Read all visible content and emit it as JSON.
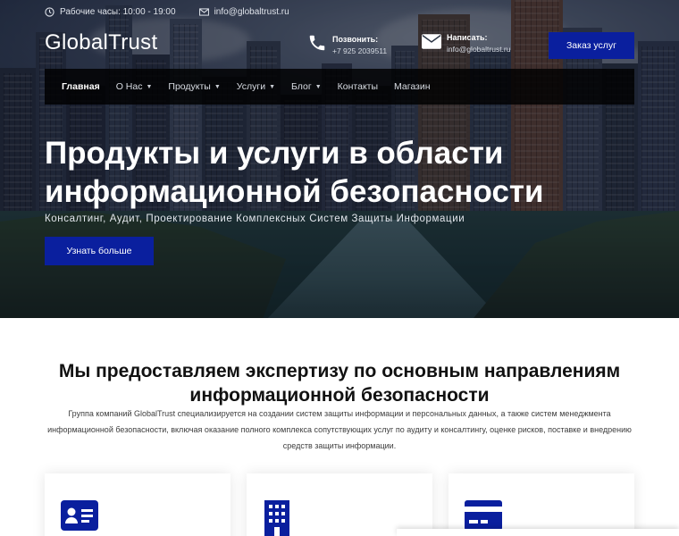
{
  "topbar": {
    "hours": "Рабочие часы: 10:00 - 19:00",
    "email": "info@globaltrust.ru",
    "clock_icon": "clock-icon",
    "mail_icon": "envelope-icon"
  },
  "header": {
    "logo": "GlobalTrust",
    "phone_label": "Позвонить:",
    "phone_value": "+7 925 2039511",
    "mail_label": "Написать:",
    "mail_value": "info@globaltrust.ru",
    "order_button": "Заказ услуг"
  },
  "nav": {
    "items": [
      {
        "label": "Главная",
        "dropdown": false,
        "active": true
      },
      {
        "label": "О Нас",
        "dropdown": true,
        "active": false
      },
      {
        "label": "Продукты",
        "dropdown": true,
        "active": false
      },
      {
        "label": "Услуги",
        "dropdown": true,
        "active": false
      },
      {
        "label": "Блог",
        "dropdown": true,
        "active": false
      },
      {
        "label": "Контакты",
        "dropdown": false,
        "active": false
      },
      {
        "label": "Магазин",
        "dropdown": false,
        "active": false
      }
    ]
  },
  "hero": {
    "title": "Продукты и услуги в области информационной безопасности",
    "subtitle": "Консалтинг, Аудит, Проектирование Комплексных Систем Защиты Информации",
    "button": "Узнать больше"
  },
  "section": {
    "title": "Мы предоставляем экспертизу по основным направлениям информационной безопасности",
    "description": "Группа компаний GlobalTrust специализируется на создании систем защиты информации и персональных данных, а также систем менеджмента информационной безопасности, включая оказание полного комплекса сопутствующих услуг по аудиту и консалтингу, оценке рисков, поставке и внедрению средств защиты информации."
  },
  "cards": [
    {
      "icon": "id-card-icon"
    },
    {
      "icon": "building-icon"
    },
    {
      "icon": "credit-card-icon"
    }
  ],
  "colors": {
    "accent": "#0a1f9e",
    "nav_bg": "#000000"
  }
}
